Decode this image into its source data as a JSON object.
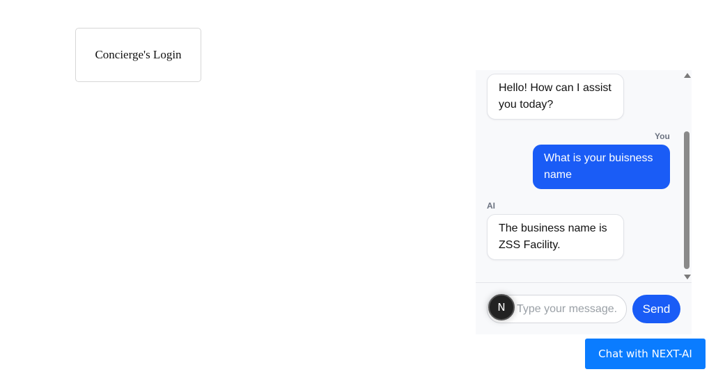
{
  "login": {
    "label": "Concierge's Login"
  },
  "chat": {
    "messages": [
      {
        "sender": "ai",
        "text": "Hello! How can I assist you today?"
      },
      {
        "sender": "user",
        "label": "You",
        "text": "What is your buisness name"
      },
      {
        "sender": "ai",
        "label": "AI",
        "text": "The business name is ZSS Facility."
      }
    ],
    "input": {
      "placeholder": "Type your message...",
      "value": ""
    },
    "send_label": "Send",
    "avatar_initial": "N"
  },
  "launcher": {
    "label": "Chat with NEXT-AI"
  },
  "colors": {
    "accent": "#1a5cf6",
    "launcher": "#0a7cff",
    "panel_bg": "#f8f9fb"
  },
  "icons": {
    "avatar": "next-logo-icon",
    "scroll_up": "scroll-up-arrow-icon",
    "scroll_down": "scroll-down-arrow-icon"
  }
}
